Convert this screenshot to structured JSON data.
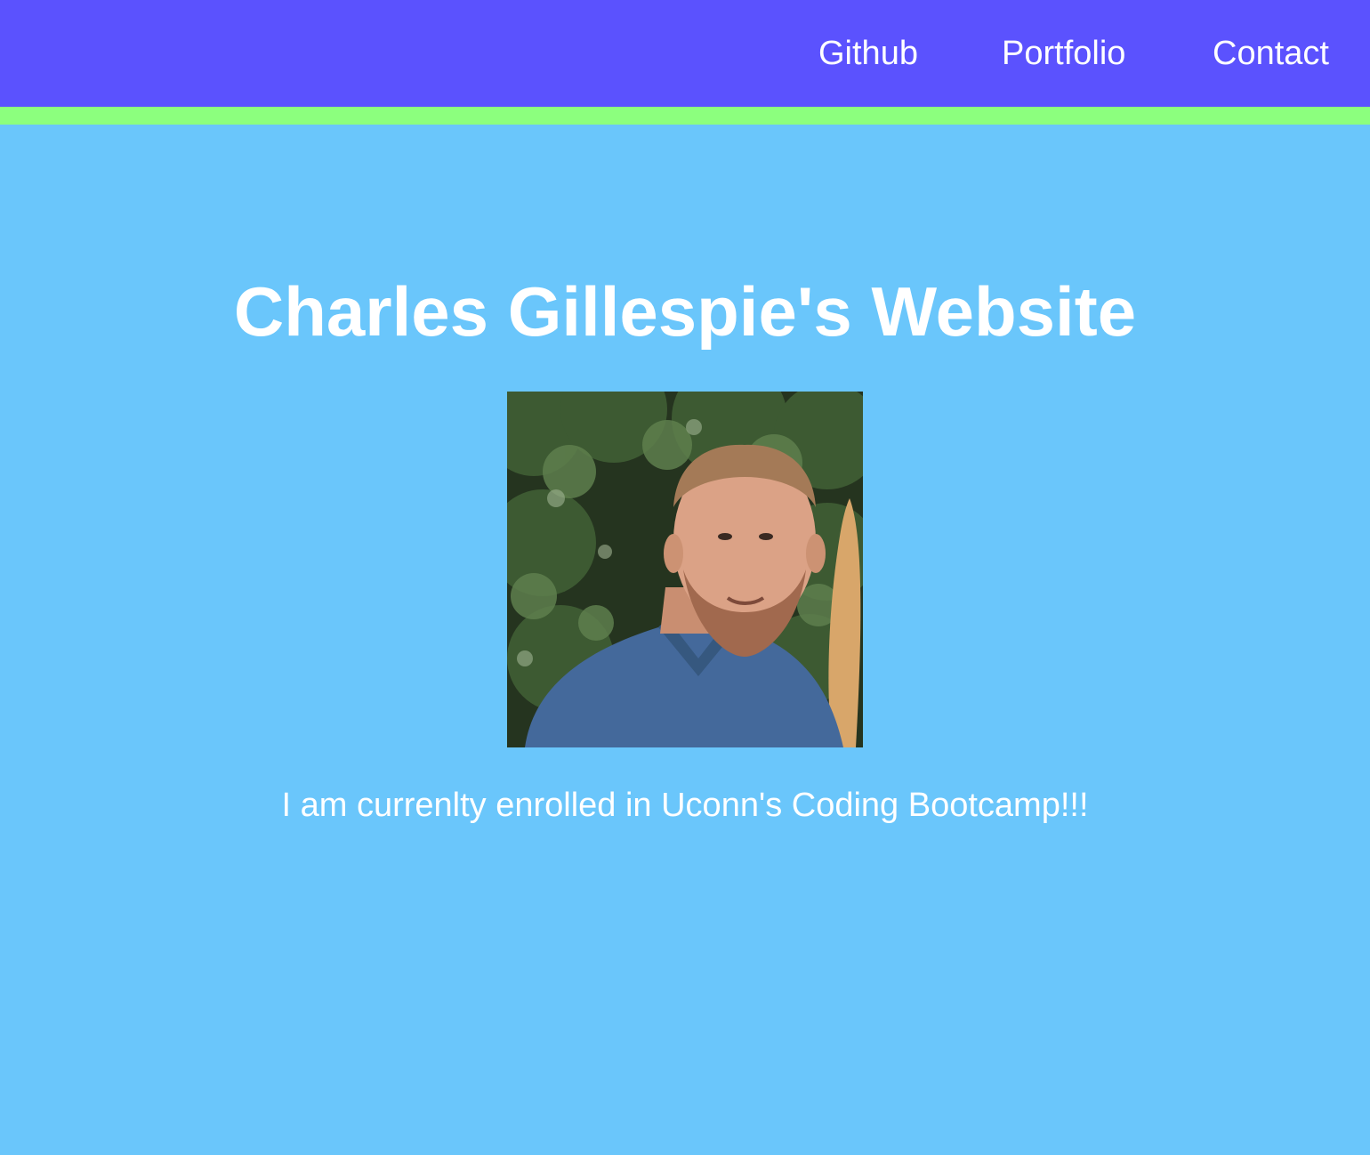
{
  "nav": {
    "links": [
      {
        "label": "Github"
      },
      {
        "label": "Portfolio"
      },
      {
        "label": "Contact"
      }
    ]
  },
  "hero": {
    "title": "Charles Gillespie's Website",
    "tagline": "I am currenlty enrolled in Uconn's Coding Bootcamp!!!"
  },
  "colors": {
    "navbar": "#5b52fe",
    "navbar_border": "#8cff7e",
    "background": "#6ac6fb",
    "text": "#ffffff"
  }
}
